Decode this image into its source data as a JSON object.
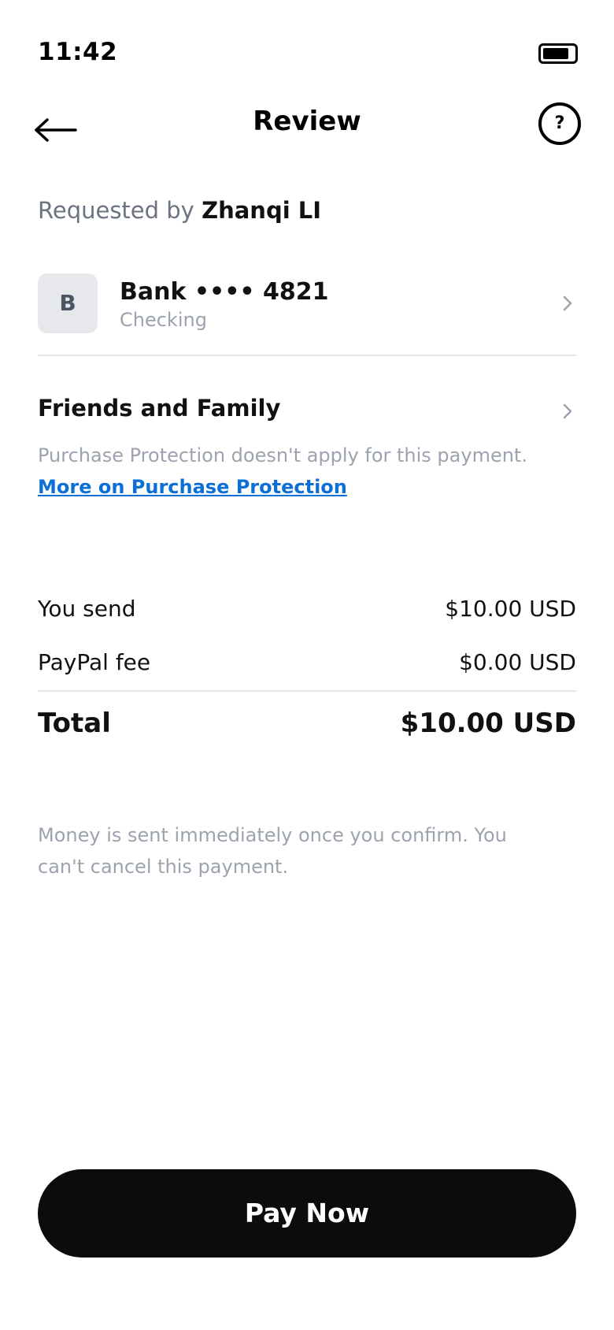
{
  "status_bar": {
    "time": "11:42"
  },
  "header": {
    "title": "Review"
  },
  "request": {
    "prefix": "Requested by",
    "name": "Zhanqi LI"
  },
  "funding": {
    "avatar_letter": "B",
    "name": "Bank •••• 4821",
    "type": "Checking"
  },
  "payment_type": {
    "label": "Friends and Family",
    "note": "Purchase Protection doesn't apply for this payment.",
    "link": "More on Purchase Protection"
  },
  "summary": {
    "send_label": "You send",
    "send_value": "$10.00 USD",
    "fee_label": "PayPal fee",
    "fee_value": "$0.00 USD",
    "total_label": "Total",
    "total_value": "$10.00 USD"
  },
  "disclaimer": "Money is sent immediately once you confirm. You can't cancel this payment.",
  "actions": {
    "pay_label": "Pay Now"
  },
  "colors": {
    "link": "#0b6fd6",
    "button_bg": "#0c0c0c",
    "muted_text": "#9ca3af"
  },
  "icons": {
    "back": "back-arrow-icon",
    "help": "question-mark-icon",
    "chevron": "chevron-right-icon",
    "battery": "battery-icon"
  }
}
